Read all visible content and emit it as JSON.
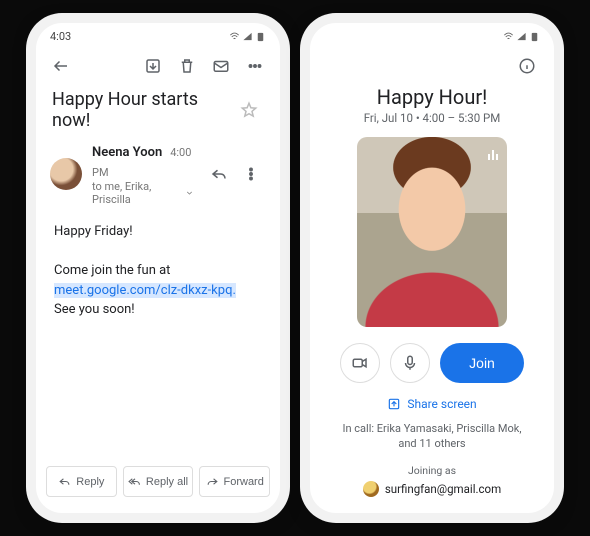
{
  "status": {
    "time": "4:03"
  },
  "gmail": {
    "subject": "Happy Hour starts now!",
    "sender": {
      "name": "Neena Yoon",
      "time": "4:00 PM",
      "to_line": "to me, Erika, Priscilla"
    },
    "body": {
      "greeting": "Happy Friday!",
      "line1": "Come join the fun at",
      "link": "meet.google.com/clz-dkxz-kpq.",
      "line2": "See you soon!"
    },
    "actions": {
      "reply": "Reply",
      "reply_all": "Reply all",
      "forward": "Forward"
    }
  },
  "meet": {
    "title": "Happy Hour!",
    "subtitle": "Fri, Jul 10  •  4:00 – 5:30 PM",
    "join_label": "Join",
    "share_label": "Share screen",
    "in_call": "In call: Erika Yamasaki, Priscilla Mok, and 11 others",
    "joining_label": "Joining as",
    "joining_user": "surfingfan@gmail.com"
  }
}
